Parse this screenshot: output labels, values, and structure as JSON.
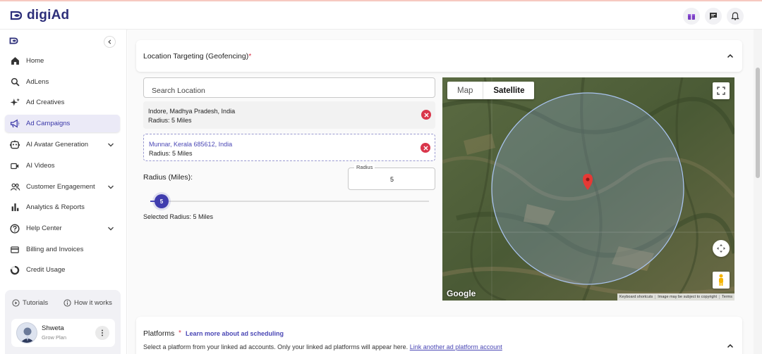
{
  "app": {
    "name": "digiAd"
  },
  "sidebar": {
    "items": [
      {
        "label": "Home",
        "icon": "home-icon"
      },
      {
        "label": "AdLens",
        "icon": "search-icon"
      },
      {
        "label": "Ad Creatives",
        "icon": "sparkle-icon"
      },
      {
        "label": "Ad Campaigns",
        "icon": "megaphone-icon",
        "active": true
      },
      {
        "label": "AI Avatar Generation",
        "icon": "avatar-icon",
        "expandable": true
      },
      {
        "label": "AI Videos",
        "icon": "video-icon"
      },
      {
        "label": "Customer Engagement",
        "icon": "people-icon",
        "expandable": true
      },
      {
        "label": "Analytics & Reports",
        "icon": "bar-chart-icon"
      },
      {
        "label": "Help Center",
        "icon": "help-icon",
        "expandable": true
      },
      {
        "label": "Billing and Invoices",
        "icon": "credit-card-icon"
      },
      {
        "label": "Credit Usage",
        "icon": "donut-icon"
      }
    ],
    "tutorials_label": "Tutorials",
    "how_it_works_label": "How it works",
    "user": {
      "name": "Shweta",
      "plan": "Grow Plan"
    }
  },
  "location_targeting": {
    "title": "Location Targeting (Geofencing)",
    "required_mark": "*",
    "search_placeholder": "Search Location",
    "locations": [
      {
        "name": "Indore, Madhya Pradesh, India",
        "radius": "Radius: 5 Miles"
      },
      {
        "name": "Munnar, Kerala 685612, India",
        "radius": "Radius: 5 Miles"
      }
    ],
    "radius_label": "Radius (Miles):",
    "radius_field_legend": "Radius",
    "radius_value": "5",
    "slider_value": "5",
    "slider_fraction": 0.04,
    "selected_radius_text": "Selected Radius: 5 Miles"
  },
  "map": {
    "type_options": [
      "Map",
      "Satellite"
    ],
    "selected_type": "Satellite",
    "logo": "Google",
    "footer": [
      "Keyboard shortcuts",
      "Image may be subject to copyright",
      "Terms"
    ]
  },
  "platforms": {
    "title": "Platforms",
    "required_mark": "*",
    "learn_more_link": "Learn more about ad scheduling",
    "description": "Select a platform from your linked ad accounts. Only your linked ad platforms will appear here.",
    "link_account": "Link another ad platform account"
  },
  "colors": {
    "accent": "#4a47b5",
    "brand": "#2d2f7a",
    "danger": "#d9364b"
  }
}
